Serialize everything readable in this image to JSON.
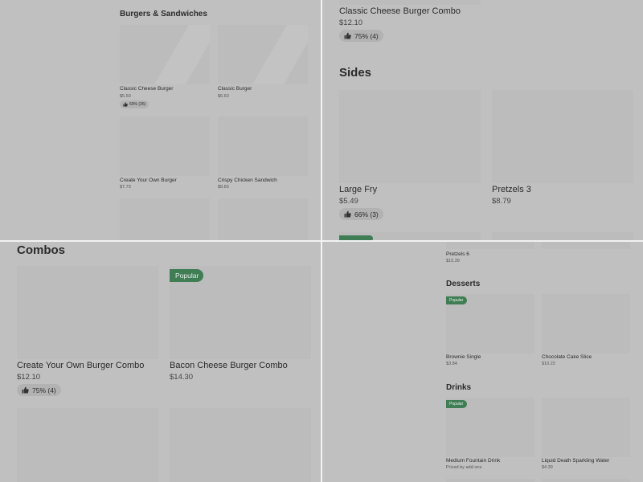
{
  "q1": {
    "section_title": "Burgers & Sandwiches",
    "items": [
      {
        "name": "Classic Cheese Burger",
        "price": "$5.50",
        "rating": "60% (35)"
      },
      {
        "name": "Classic Burger",
        "price": "$6.60"
      },
      {
        "name": "Create Your Own Burger",
        "price": "$7.70"
      },
      {
        "name": "Crispy Chicken Sandwich",
        "price": "$8.80"
      }
    ]
  },
  "q2": {
    "top_item": {
      "name": "Classic Cheese Burger Combo",
      "price": "$12.10",
      "rating": "75% (4)"
    },
    "section_title": "Sides",
    "items": [
      {
        "name": "Large Fry",
        "price": "$5.49",
        "rating": "66% (3)"
      },
      {
        "name": "Pretzels 3",
        "price": "$8.79"
      }
    ]
  },
  "q3": {
    "section_title": "Combos",
    "items": [
      {
        "name": "Create Your Own Burger Combo",
        "price": "$12.10",
        "rating": "75% (4)"
      },
      {
        "name": "Bacon Cheese Burger Combo",
        "price": "$14.30",
        "badge": "Popular"
      }
    ]
  },
  "q4": {
    "top_item": {
      "name": "Pretzels 6",
      "price": "$15.39"
    },
    "desserts": {
      "title": "Desserts",
      "items": [
        {
          "name": "Brownie Single",
          "price": "$3.84",
          "badge": "Popular"
        },
        {
          "name": "Chocolate Cake Slice",
          "price": "$10.22"
        }
      ]
    },
    "drinks": {
      "title": "Drinks",
      "items": [
        {
          "name": "Medium Fountain Drink",
          "price": "Priced by add-ons",
          "badge": "Popular"
        },
        {
          "name": "Liquid Death Sparkling Water",
          "price": "$4.39"
        }
      ]
    }
  },
  "colors": {
    "background": "#c0c0c0",
    "image_placeholder": "#bcbcbc",
    "badge": "#3f7d54",
    "divider": "#f2f2f2"
  },
  "icons": {
    "rating": "thumbs-up-icon"
  }
}
